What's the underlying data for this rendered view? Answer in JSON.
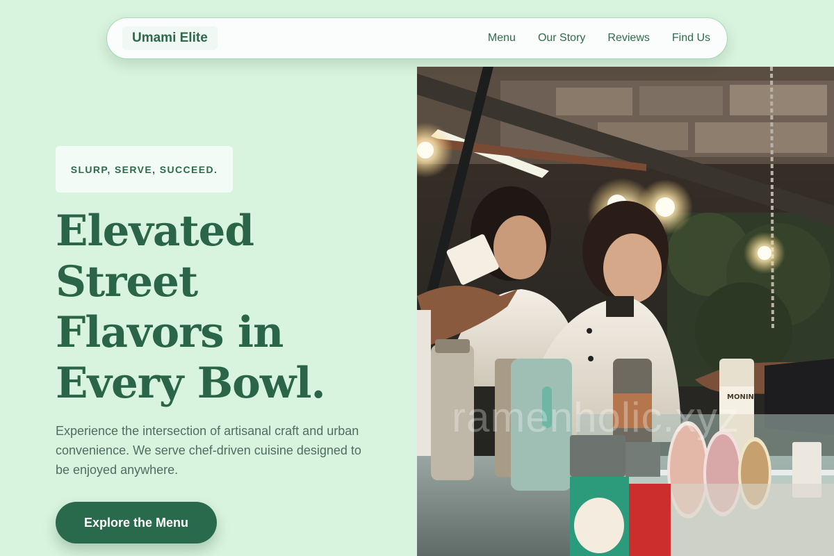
{
  "nav": {
    "brand": "Umami Elite",
    "links": [
      "Menu",
      "Our Story",
      "Reviews",
      "Find Us"
    ]
  },
  "hero": {
    "tagline": "SLURP, SERVE, SUCCEED.",
    "headline_lines": [
      "Elevated",
      "Street",
      "Flavors in",
      "Every Bowl."
    ],
    "description": "Experience the intersection of artisanal craft and urban convenience. We serve chef-driven cuisine designed to be enjoyed anywhere.",
    "cta_label": "Explore the Menu"
  },
  "photo": {
    "watermark": "ramenholic.xyz",
    "bottle_label": "MONIN"
  },
  "colors": {
    "background": "#d8f3de",
    "primary": "#2a6a4c",
    "nav_bg": "#fbfdfc",
    "text_muted": "#4f6f62"
  }
}
